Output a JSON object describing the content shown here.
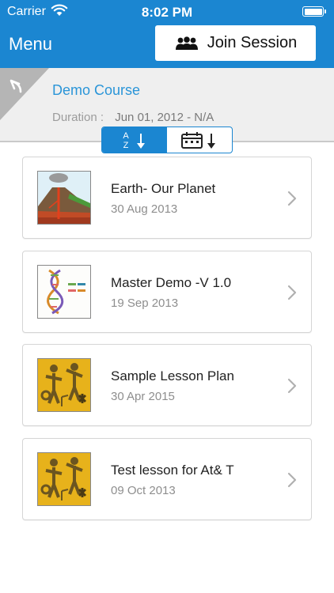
{
  "status_bar": {
    "carrier": "Carrier",
    "time": "8:02 PM",
    "battery_level": 1.0
  },
  "header": {
    "menu_label": "Menu",
    "join_label": "Join Session"
  },
  "course": {
    "title": "Demo Course",
    "duration_label": "Duration :",
    "duration_value": "Jun 01, 2012 - N/A"
  },
  "sort": {
    "alpha_top": "A",
    "alpha_bottom": "Z",
    "options": [
      "alphabetical",
      "date"
    ],
    "selected": "alphabetical"
  },
  "lessons": [
    {
      "title": "Earth- Our Planet",
      "date": "30 Aug 2013",
      "thumb": "volcano-thumbnail"
    },
    {
      "title": "Master Demo -V 1.0",
      "date": "19 Sep 2013",
      "thumb": "dna-thumbnail"
    },
    {
      "title": "Sample Lesson Plan",
      "date": "30 Apr 2015",
      "thumb": "music-thumbnail"
    },
    {
      "title": "Test lesson for At& T",
      "date": "09 Oct 2013",
      "thumb": "music-thumbnail"
    }
  ],
  "colors": {
    "accent": "#1b86d1",
    "link": "#2a95d8",
    "header_bg": "#efefef"
  }
}
